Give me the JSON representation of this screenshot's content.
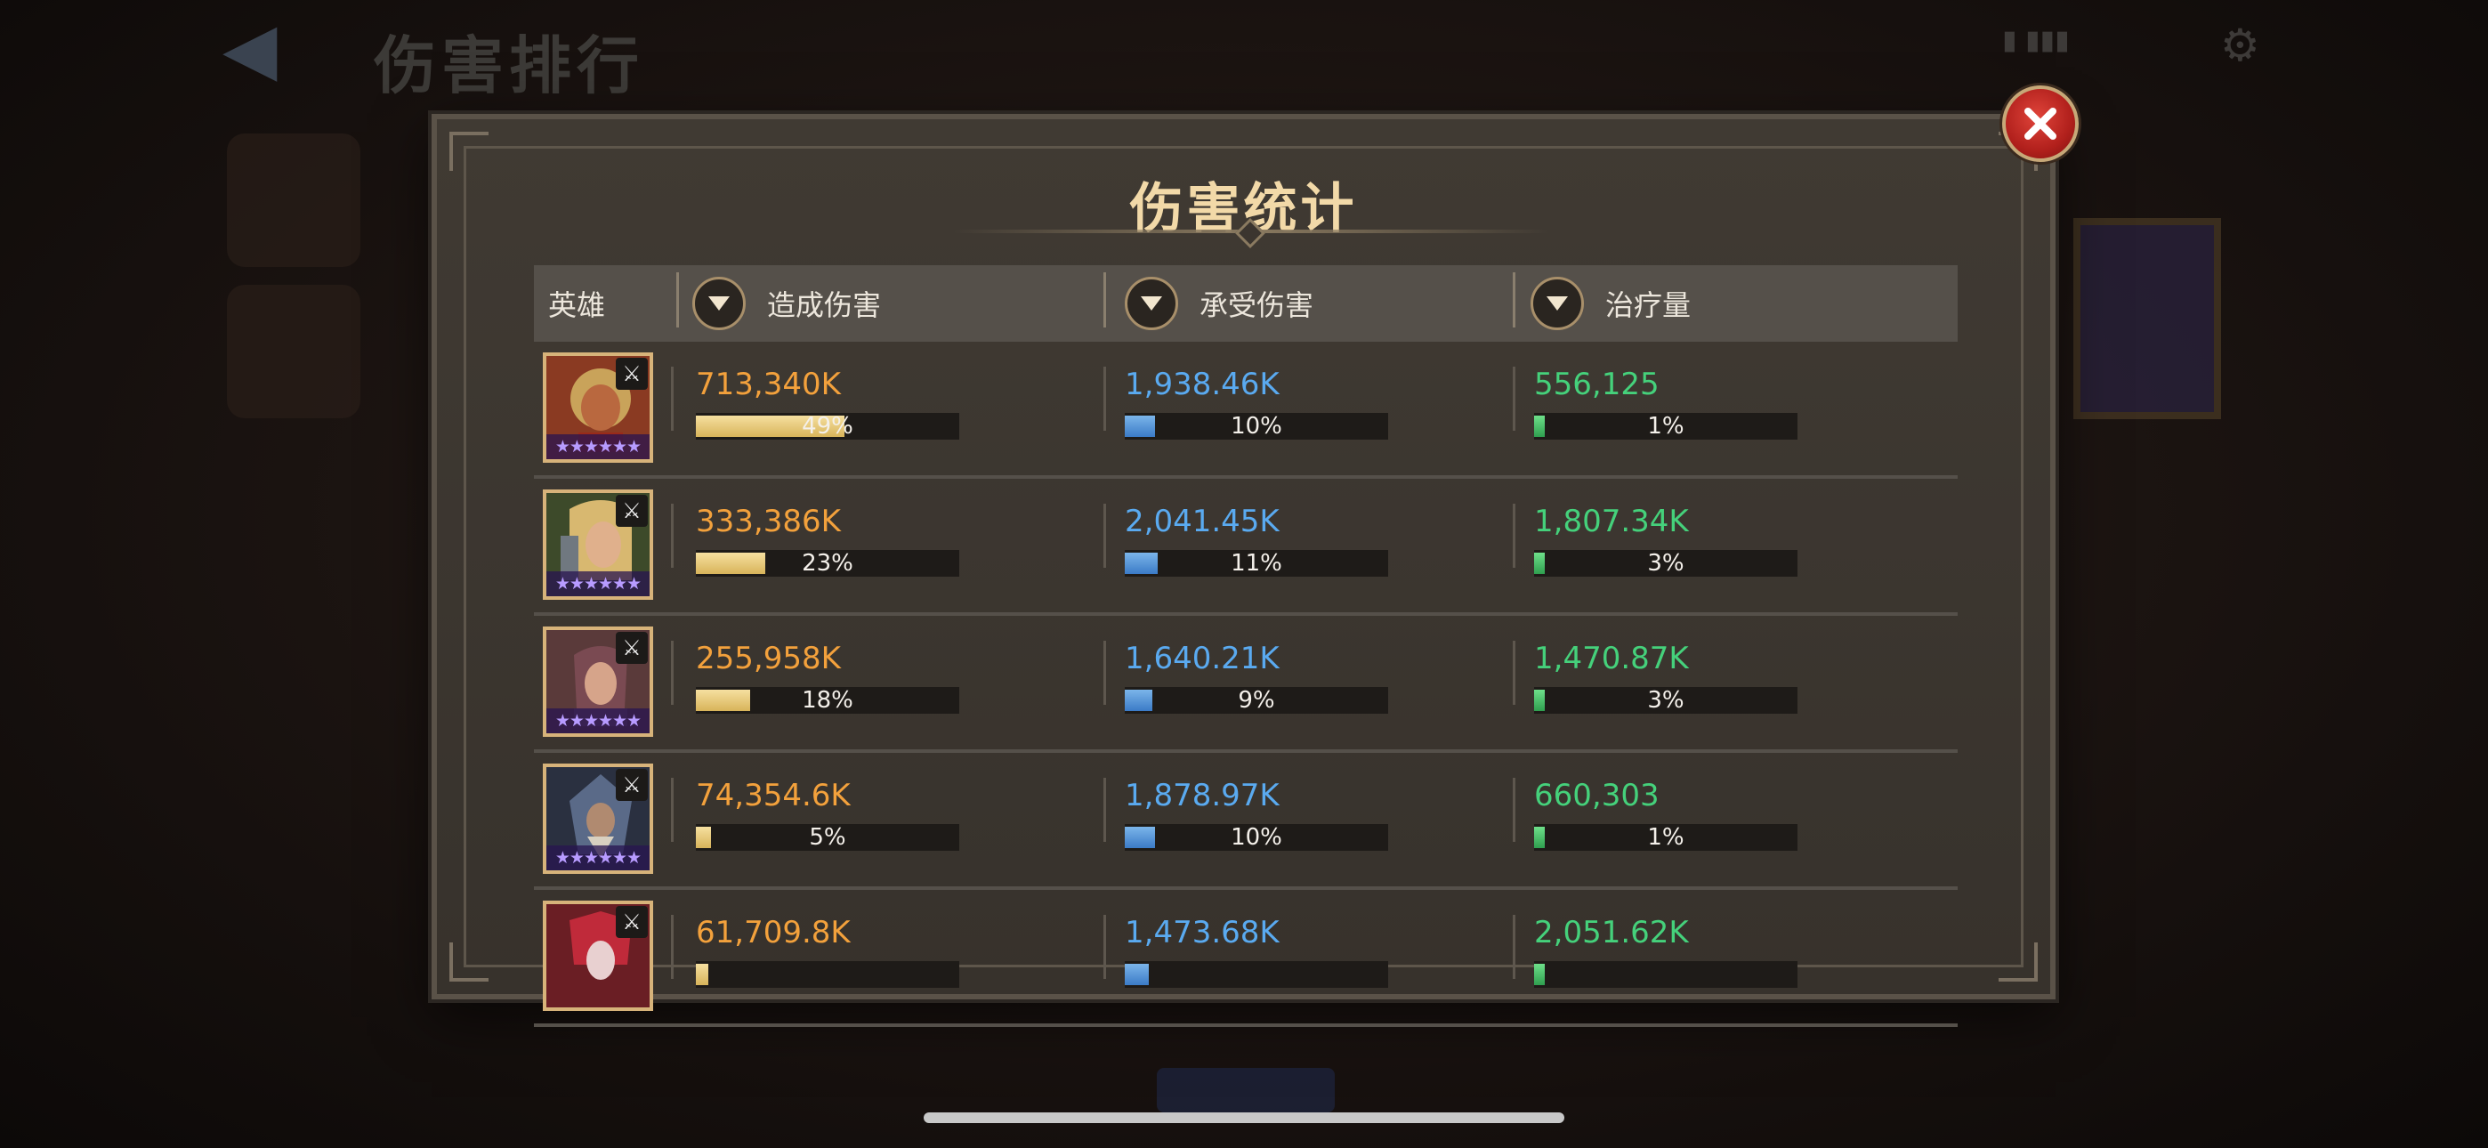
{
  "background": {
    "title": "伤害排行"
  },
  "modal": {
    "title": "伤害统计"
  },
  "table": {
    "headers": {
      "hero": "英雄",
      "damage_dealt": "造成伤害",
      "damage_taken": "承受伤害",
      "healing": "治疗量"
    },
    "rows": [
      {
        "damage_dealt": {
          "value": "713,340K",
          "percent": "49%",
          "fraction": 0.49
        },
        "damage_taken": {
          "value": "1,938.46K",
          "percent": "10%",
          "fraction": 0.1
        },
        "healing": {
          "value": "556,125",
          "percent": "1%",
          "fraction": 0.01
        }
      },
      {
        "damage_dealt": {
          "value": "333,386K",
          "percent": "23%",
          "fraction": 0.23
        },
        "damage_taken": {
          "value": "2,041.45K",
          "percent": "11%",
          "fraction": 0.11
        },
        "healing": {
          "value": "1,807.34K",
          "percent": "3%",
          "fraction": 0.03
        }
      },
      {
        "damage_dealt": {
          "value": "255,958K",
          "percent": "18%",
          "fraction": 0.18
        },
        "damage_taken": {
          "value": "1,640.21K",
          "percent": "9%",
          "fraction": 0.09
        },
        "healing": {
          "value": "1,470.87K",
          "percent": "3%",
          "fraction": 0.03
        }
      },
      {
        "damage_dealt": {
          "value": "74,354.6K",
          "percent": "5%",
          "fraction": 0.05
        },
        "damage_taken": {
          "value": "1,878.97K",
          "percent": "10%",
          "fraction": 0.1
        },
        "healing": {
          "value": "660,303",
          "percent": "1%",
          "fraction": 0.01
        }
      },
      {
        "damage_dealt": {
          "value": "61,709.8K",
          "percent": "",
          "fraction": 0.04
        },
        "damage_taken": {
          "value": "1,473.68K",
          "percent": "",
          "fraction": 0.08
        },
        "healing": {
          "value": "2,051.62K",
          "percent": "",
          "fraction": 0.03
        }
      }
    ]
  },
  "colors": {
    "damage": "#f3a13c",
    "taken": "#5aaaf0",
    "heal": "#45d17b",
    "close_button": "#c42a22"
  },
  "icons": {
    "close": "close-x-icon",
    "sort": "triangle-down-icon",
    "weapon": "sword-icon",
    "stars": "star-rating-icon"
  }
}
